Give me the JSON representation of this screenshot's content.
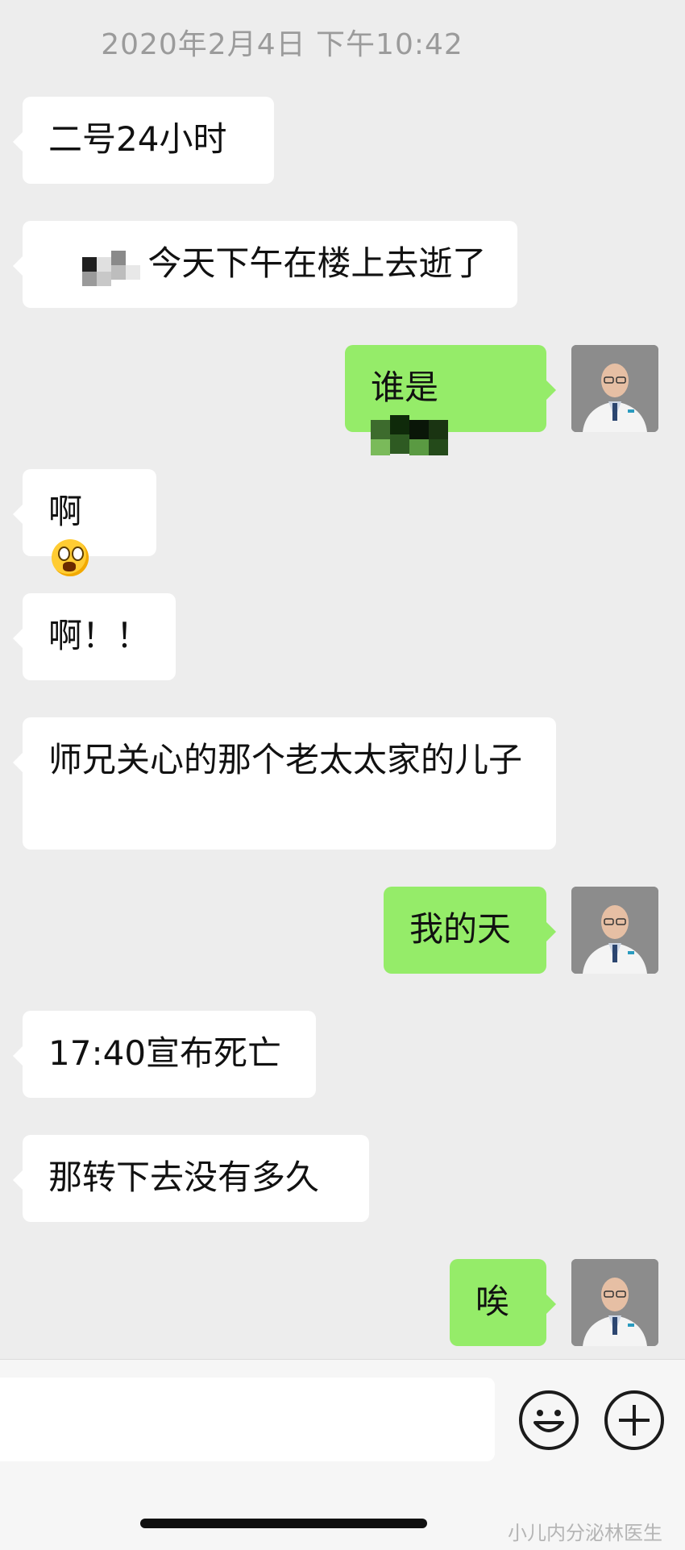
{
  "chat": {
    "timestamp": "2020年2月4日 下午10:42",
    "messages": [
      {
        "side": "left",
        "text": "二号24小时"
      },
      {
        "side": "left",
        "text": "今天下午在楼上去逝了"
      },
      {
        "side": "right",
        "text": "谁是"
      },
      {
        "side": "left",
        "text": "啊"
      },
      {
        "side": "left",
        "text": "啊！！"
      },
      {
        "side": "left",
        "text": "师兄关心的那个老太太家的儿子"
      },
      {
        "side": "right",
        "text": "我的天"
      },
      {
        "side": "left",
        "text": "17:40宣布死亡"
      },
      {
        "side": "left",
        "text": "那转下去没有多久"
      },
      {
        "side": "right",
        "text": "唉"
      }
    ]
  },
  "input_bar": {
    "emoji_button": "emoji-icon",
    "more_button": "plus-icon"
  },
  "watermark": "小儿内分泌林医生",
  "colors": {
    "background": "#ededed",
    "left_bubble": "#ffffff",
    "right_bubble": "#95ec69"
  }
}
